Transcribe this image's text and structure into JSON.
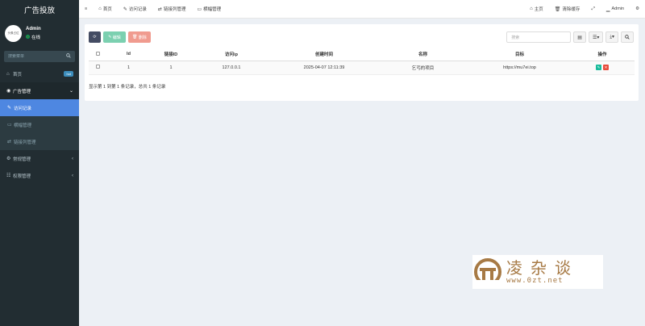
{
  "brand": {
    "title": "广告投放"
  },
  "user": {
    "avatar_text": "头像占位",
    "name": "Admin",
    "status": "在线"
  },
  "sidebar": {
    "search_placeholder": "搜索菜单",
    "items": [
      {
        "label": "首页",
        "badge": "hot",
        "icon": "home-icon"
      },
      {
        "label": "广告管理",
        "icon": "ad-icon"
      },
      {
        "label": "访问记录",
        "icon": "pencil-icon"
      },
      {
        "label": "横幅管理",
        "icon": "banner-icon"
      },
      {
        "label": "链接列管理",
        "icon": "link-icon"
      },
      {
        "label": "常规管理",
        "icon": "cogs-icon"
      },
      {
        "label": "权限管理",
        "icon": "users-icon"
      }
    ]
  },
  "topnav": {
    "tabs": [
      {
        "label": "首页"
      },
      {
        "label": "访问记录"
      },
      {
        "label": "链接列管理"
      },
      {
        "label": "横幅管理"
      }
    ],
    "home_link": "主页",
    "clear_cache": "清除缓存",
    "admin": "Admin"
  },
  "toolbar": {
    "edit": "编辑",
    "delete": "删除",
    "search_placeholder": "搜索"
  },
  "table": {
    "headers": [
      "Id",
      "链接ID",
      "访问ip",
      "创建时间",
      "名称",
      "目标",
      "操作"
    ],
    "rows": [
      {
        "id": "1",
        "link_id": "1",
        "ip": "127.0.0.1",
        "created": "2025-04-07 12:11:39",
        "name": "乞丐的项目",
        "target": "https://mu7ei.top"
      }
    ]
  },
  "summary": "显示第 1 到第 1 条记录，总共 1 条记录",
  "watermark": {
    "cn": "凌杂谈",
    "url": "www.0zt.net"
  },
  "colors": {
    "sidebar": "#222d32",
    "active": "#4e87e1",
    "edit_btn": "#18bc9c",
    "delete_btn": "#e74c3c"
  }
}
